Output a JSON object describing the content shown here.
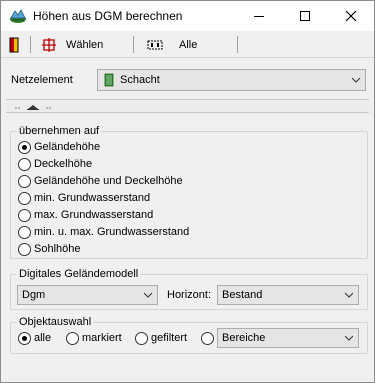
{
  "window": {
    "title": "Höhen aus DGM berechnen",
    "icon": "terrain-app-icon"
  },
  "toolbar": {
    "select_label": "Wählen",
    "all_label": "Alle"
  },
  "netzelement": {
    "label": "Netzelement",
    "value": "Schacht"
  },
  "uebernehmen": {
    "title": "übernehmen auf",
    "options": [
      {
        "label": "Geländehöhe",
        "checked": true
      },
      {
        "label": "Deckelhöhe",
        "checked": false
      },
      {
        "label": "Geländehöhe und Deckelhöhe",
        "checked": false
      },
      {
        "label": "min. Grundwasserstand",
        "checked": false
      },
      {
        "label": "max. Grundwasserstand",
        "checked": false
      },
      {
        "label": "min. u. max. Grundwasserstand",
        "checked": false
      },
      {
        "label": "Sohlhöhe",
        "checked": false
      }
    ]
  },
  "dgm": {
    "title": "Digitales Geländemodell",
    "model_value": "Dgm",
    "horizont_label": "Horizont:",
    "horizont_value": "Bestand"
  },
  "objektauswahl": {
    "title": "Objektauswahl",
    "options": [
      {
        "label": "alle",
        "checked": true
      },
      {
        "label": "markiert",
        "checked": false
      },
      {
        "label": "gefiltert",
        "checked": false
      }
    ],
    "bereiche_value": "Bereiche"
  },
  "colors": {
    "window_bg": "#f0f0f0",
    "titlebar_bg": "#ffffff",
    "combo_bg": "#e5e5e5",
    "toolbar_icon_red": "#c00000",
    "schacht_icon_green": "#3a8a3a"
  }
}
